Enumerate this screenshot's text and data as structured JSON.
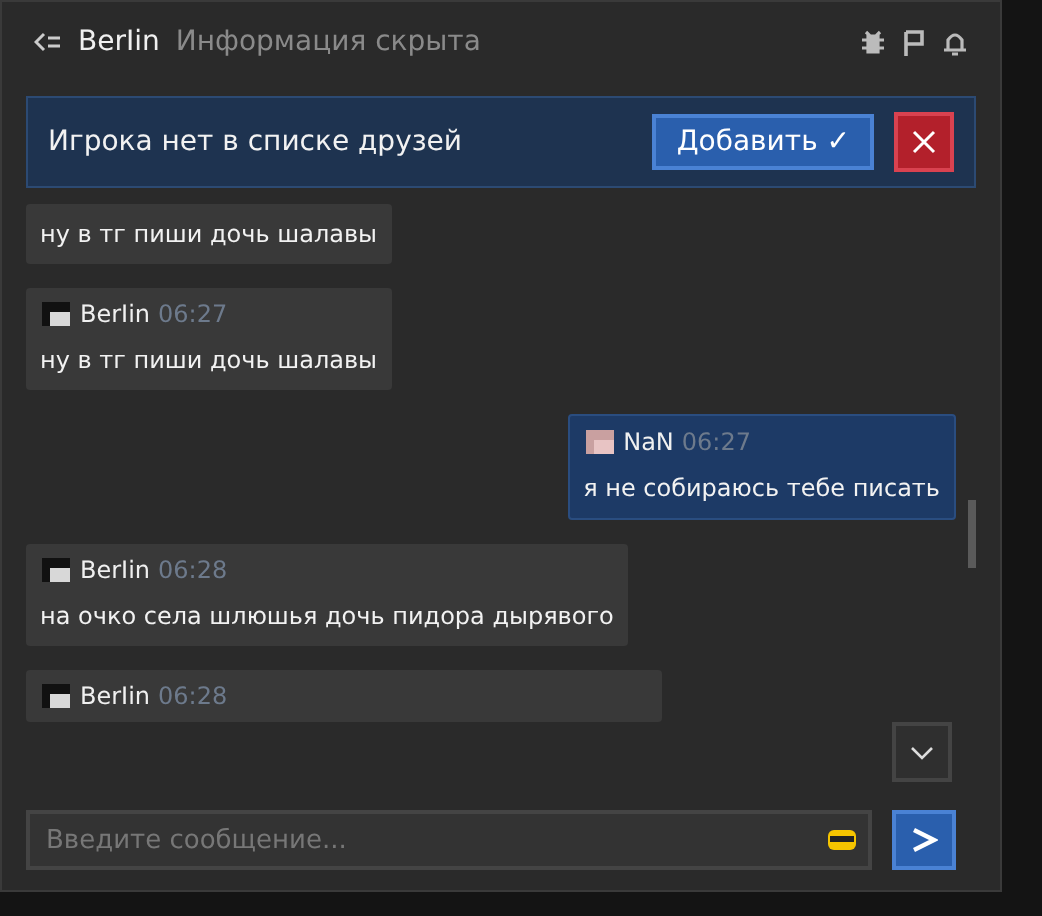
{
  "header": {
    "name": "BerIin",
    "subtitle": "Информация скрыта"
  },
  "banner": {
    "text": "Игрока нет в списке друзей",
    "add_button": "Добавить ✓"
  },
  "messages": [
    {
      "kind": "incoming",
      "text": "ну в тг пиши дочь шалавы"
    },
    {
      "kind": "incoming",
      "author": "BerIin",
      "time": "06:27",
      "text": "ну в тг пиши дочь шалавы"
    },
    {
      "kind": "outgoing",
      "author": "NaN",
      "time": "06:27",
      "text": "я не собираюсь тебе писать"
    },
    {
      "kind": "incoming",
      "author": "BerIin",
      "time": "06:28",
      "text": "на очко села шлюшья дочь пидора дырявого"
    },
    {
      "kind": "incoming",
      "author": "BerIin",
      "time": "06:28"
    }
  ],
  "input": {
    "placeholder": "Введите сообщение..."
  }
}
